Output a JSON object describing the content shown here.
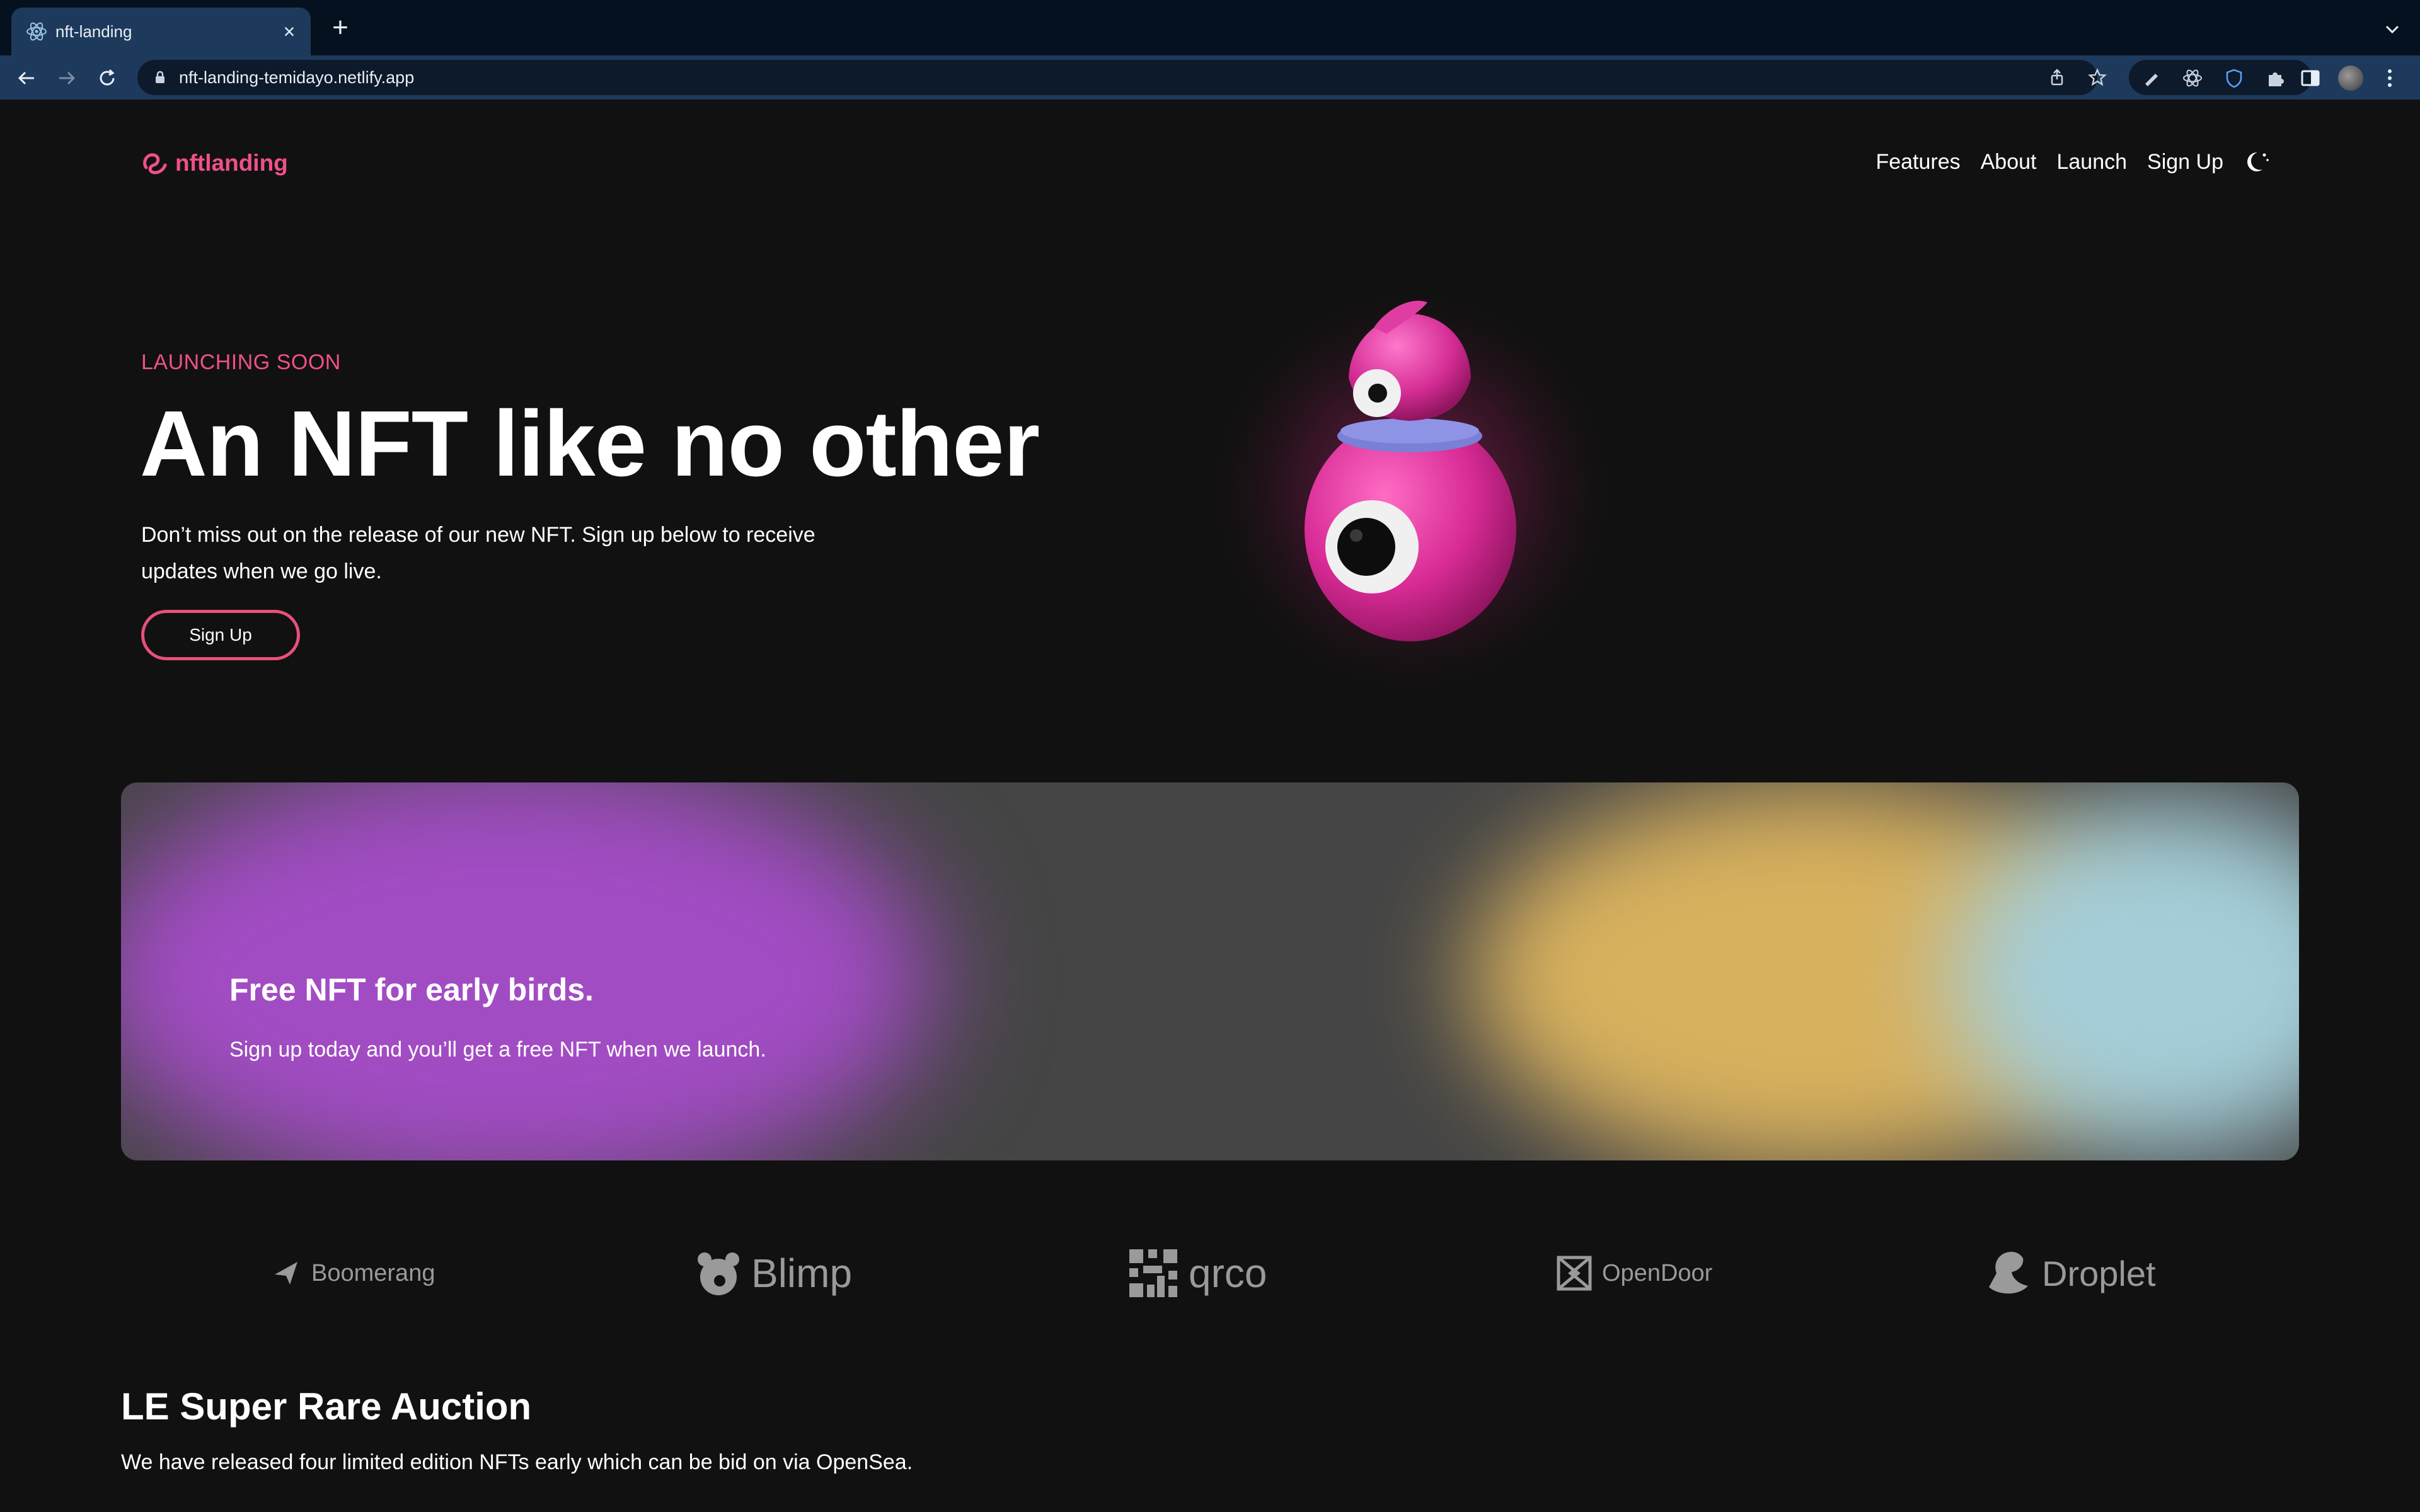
{
  "browser": {
    "tab_title": "nft-landing",
    "url": "nft-landing-temidayo.netlify.app"
  },
  "site": {
    "logo_text": "nftlanding",
    "nav": [
      "Features",
      "About",
      "Launch",
      "Sign Up"
    ]
  },
  "hero": {
    "eyebrow": "LAUNCHING SOON",
    "title": "An NFT like no other",
    "text": "Don’t miss out on the release of our new NFT. Sign up below to receive updates when we go live.",
    "button": "Sign Up"
  },
  "promo": {
    "title": "Free NFT for early birds.",
    "text": "Sign up today and you’ll get a free NFT when we launch."
  },
  "brands": [
    "Boomerang",
    "Blimp",
    "qrco",
    "OpenDoor",
    "Droplet"
  ],
  "auction": {
    "title": "LE Super Rare Auction",
    "text": "We have released four limited edition NFTs early which can be bid on via OpenSea."
  },
  "colors": {
    "accent": "#f0508a",
    "page_bg": "#111111",
    "chrome_bg": "#1d3a5c"
  }
}
